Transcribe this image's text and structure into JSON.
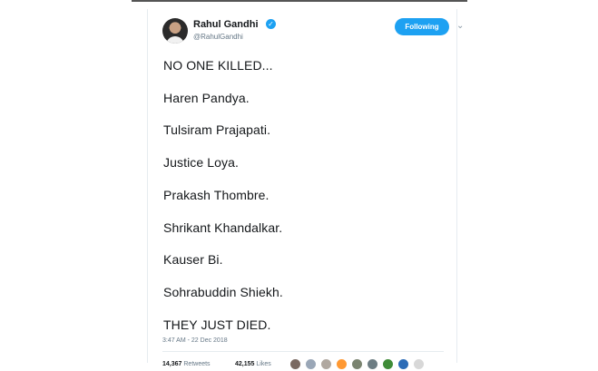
{
  "tweet": {
    "author": {
      "name": "Rahul Gandhi",
      "handle": "@RahulGandhi",
      "verified_glyph": "✓"
    },
    "follow_button": "Following",
    "menu_glyph": "⌄",
    "lines": [
      "NO ONE KILLED...",
      "Haren Pandya.",
      "Tulsiram Prajapati.",
      "Justice Loya.",
      "Prakash Thombre.",
      "Shrikant Khandalkar.",
      "Kauser Bi.",
      "Sohrabuddin Shiekh.",
      "THEY JUST DIED."
    ],
    "timestamp": "3:47 AM - 22 Dec 2018",
    "retweets_count": "14,367",
    "retweets_label": "Retweets",
    "likes_count": "42,155",
    "likes_label": "Likes",
    "liker_avatar_colors": [
      "#7a6a62",
      "#9aa7b7",
      "#b0a8a0",
      "#ff9933",
      "#7a8470",
      "#6d7d83",
      "#3f8c38",
      "#2b6bb6",
      "#d8d8d8"
    ]
  }
}
